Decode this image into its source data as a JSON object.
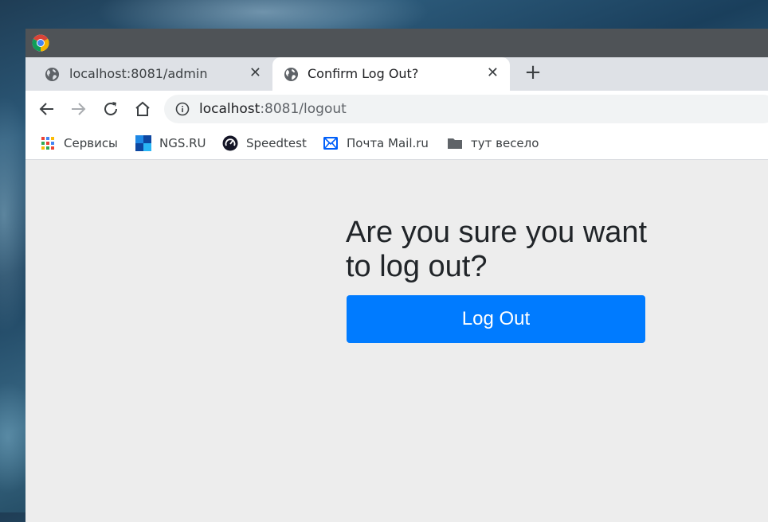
{
  "tabs": [
    {
      "title": "localhost:8081/admin",
      "close": "✕"
    },
    {
      "title": "Confirm Log Out?",
      "close": "✕"
    }
  ],
  "new_tab_label": "+",
  "address": {
    "host": "localhost",
    "rest": ":8081/logout"
  },
  "bookmarks": [
    {
      "label": "Сервисы",
      "icon": "apps-grid-icon"
    },
    {
      "label": "NGS.RU",
      "icon": "ngs-icon"
    },
    {
      "label": "Speedtest",
      "icon": "speedtest-icon"
    },
    {
      "label": "Почта Mail.ru",
      "icon": "mail-icon"
    },
    {
      "label": "тут весело",
      "icon": "folder-icon"
    }
  ],
  "page": {
    "heading": "Are you sure you want to log out?",
    "button_label": "Log Out"
  },
  "colors": {
    "button": "#007bff",
    "page_background": "#ededed",
    "titlebar": "#4f5357",
    "tabstrip": "#dee1e6"
  }
}
